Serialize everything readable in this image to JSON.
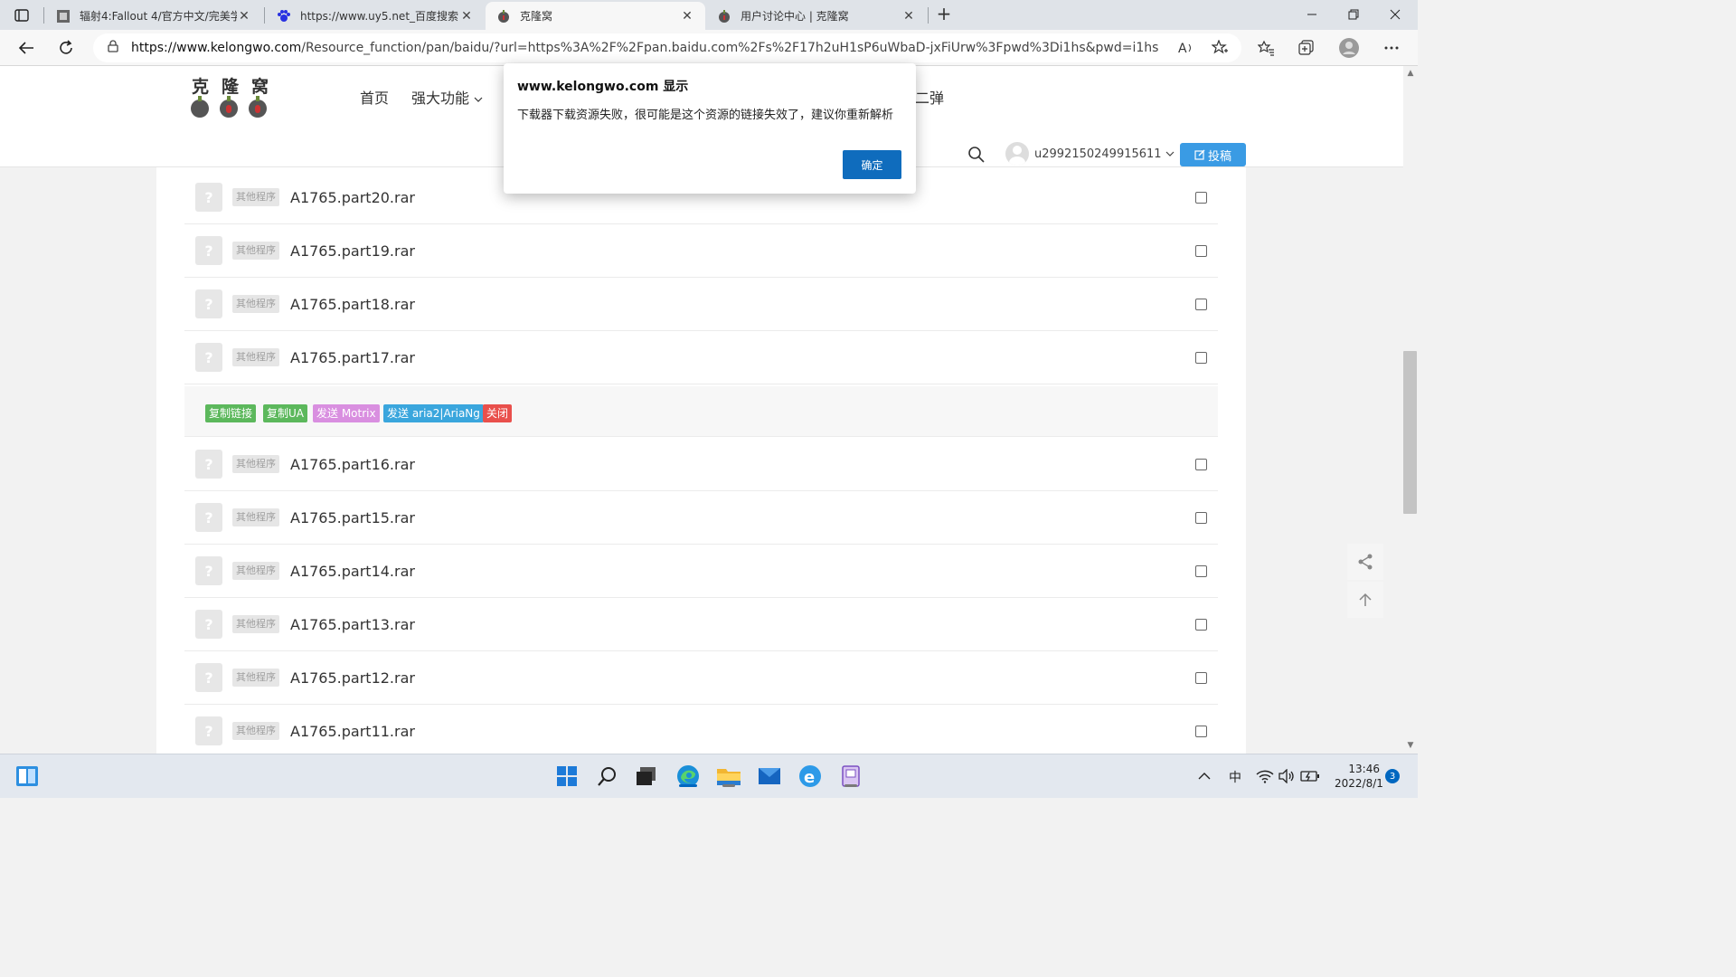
{
  "browser": {
    "tabs": [
      {
        "title": "辐射4:Fallout 4/官方中文/完美学",
        "favicon": "game-icon"
      },
      {
        "title": "https://www.uy5.net_百度搜索",
        "favicon": "baidu-paw-icon"
      },
      {
        "title": "克隆窝",
        "favicon": "kelongwo-bug-icon",
        "active": true
      },
      {
        "title": "用户讨论中心 | 克隆窝",
        "favicon": "kelongwo-bug-icon"
      }
    ],
    "url_host": "https://www.kelongwo.com",
    "url_path": "/Resource_function/pan/baidu/?url=https%3A%2F%2Fpan.baidu.com%2Fs%2F17h2uH1sP6uWbaD-jxFiUrw%3Fpwd%3Di1hs&pwd=i1hs"
  },
  "site": {
    "logo_chars": [
      "克",
      "隆",
      "窝"
    ],
    "menu": [
      {
        "label": "首页"
      },
      {
        "label": "强大功能"
      },
      {
        "label": "二弹"
      }
    ],
    "username": "u2992150249915611",
    "post_button": "投稿"
  },
  "files_top": [
    {
      "tag": "其他程序",
      "name": "A1765.part20.rar"
    },
    {
      "tag": "其他程序",
      "name": "A1765.part19.rar"
    },
    {
      "tag": "其他程序",
      "name": "A1765.part18.rar"
    },
    {
      "tag": "其他程序",
      "name": "A1765.part17.rar"
    }
  ],
  "actions": [
    {
      "label": "复制链接",
      "color": "#5cb85c"
    },
    {
      "label": "复制UA",
      "color": "#5cb85c"
    },
    {
      "label": "发送 Motrix",
      "color": "#d98fe0"
    },
    {
      "label": "发送 aria2|AriaNg",
      "color": "#3aa6dd"
    },
    {
      "label": "关闭",
      "color": "#e9504c"
    }
  ],
  "files_bottom": [
    {
      "tag": "其他程序",
      "name": "A1765.part16.rar"
    },
    {
      "tag": "其他程序",
      "name": "A1765.part15.rar"
    },
    {
      "tag": "其他程序",
      "name": "A1765.part14.rar"
    },
    {
      "tag": "其他程序",
      "name": "A1765.part13.rar"
    },
    {
      "tag": "其他程序",
      "name": "A1765.part12.rar"
    },
    {
      "tag": "其他程序",
      "name": "A1765.part11.rar"
    }
  ],
  "file_icon_glyph": "?",
  "dialog": {
    "title": "www.kelongwo.com 显示",
    "message": "下载器下载资源失败，很可能是这个资源的链接失效了，建议你重新解析",
    "ok_label": "确定"
  },
  "taskbar": {
    "ime": "中",
    "time": "13:46",
    "date": "2022/8/1",
    "notifications": "3"
  }
}
